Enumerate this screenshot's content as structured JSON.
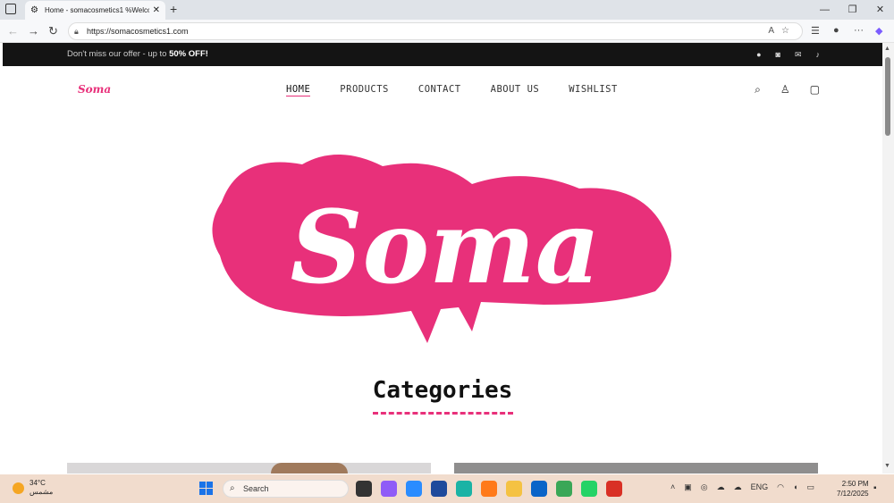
{
  "browser": {
    "tab_title": "Home - somacosmetics1 %Welco",
    "url": "https://somacosmetics1.com",
    "new_tab": "+",
    "close_tab": "✕"
  },
  "announcement": {
    "text": "Don't miss our offer - up to ",
    "highlight": "50% OFF!"
  },
  "site": {
    "logo_text": "Soma",
    "nav": [
      "HOME",
      "PRODUCTS",
      "CONTACT",
      "ABOUT US",
      "WISHLIST"
    ],
    "hero_logo_text": "Soma",
    "categories_title": "Categories"
  },
  "social_icons": [
    "facebook-icon",
    "instagram-icon",
    "email-icon",
    "tiktok-icon"
  ],
  "colors": {
    "brand_pink": "#e8307a",
    "announcement_bg": "#141414"
  },
  "taskbar": {
    "temperature": "34°C",
    "weather_desc": "مشمس",
    "search_placeholder": "Search",
    "language": "ENG",
    "time": "2:50 PM",
    "date": "7/12/2025"
  }
}
